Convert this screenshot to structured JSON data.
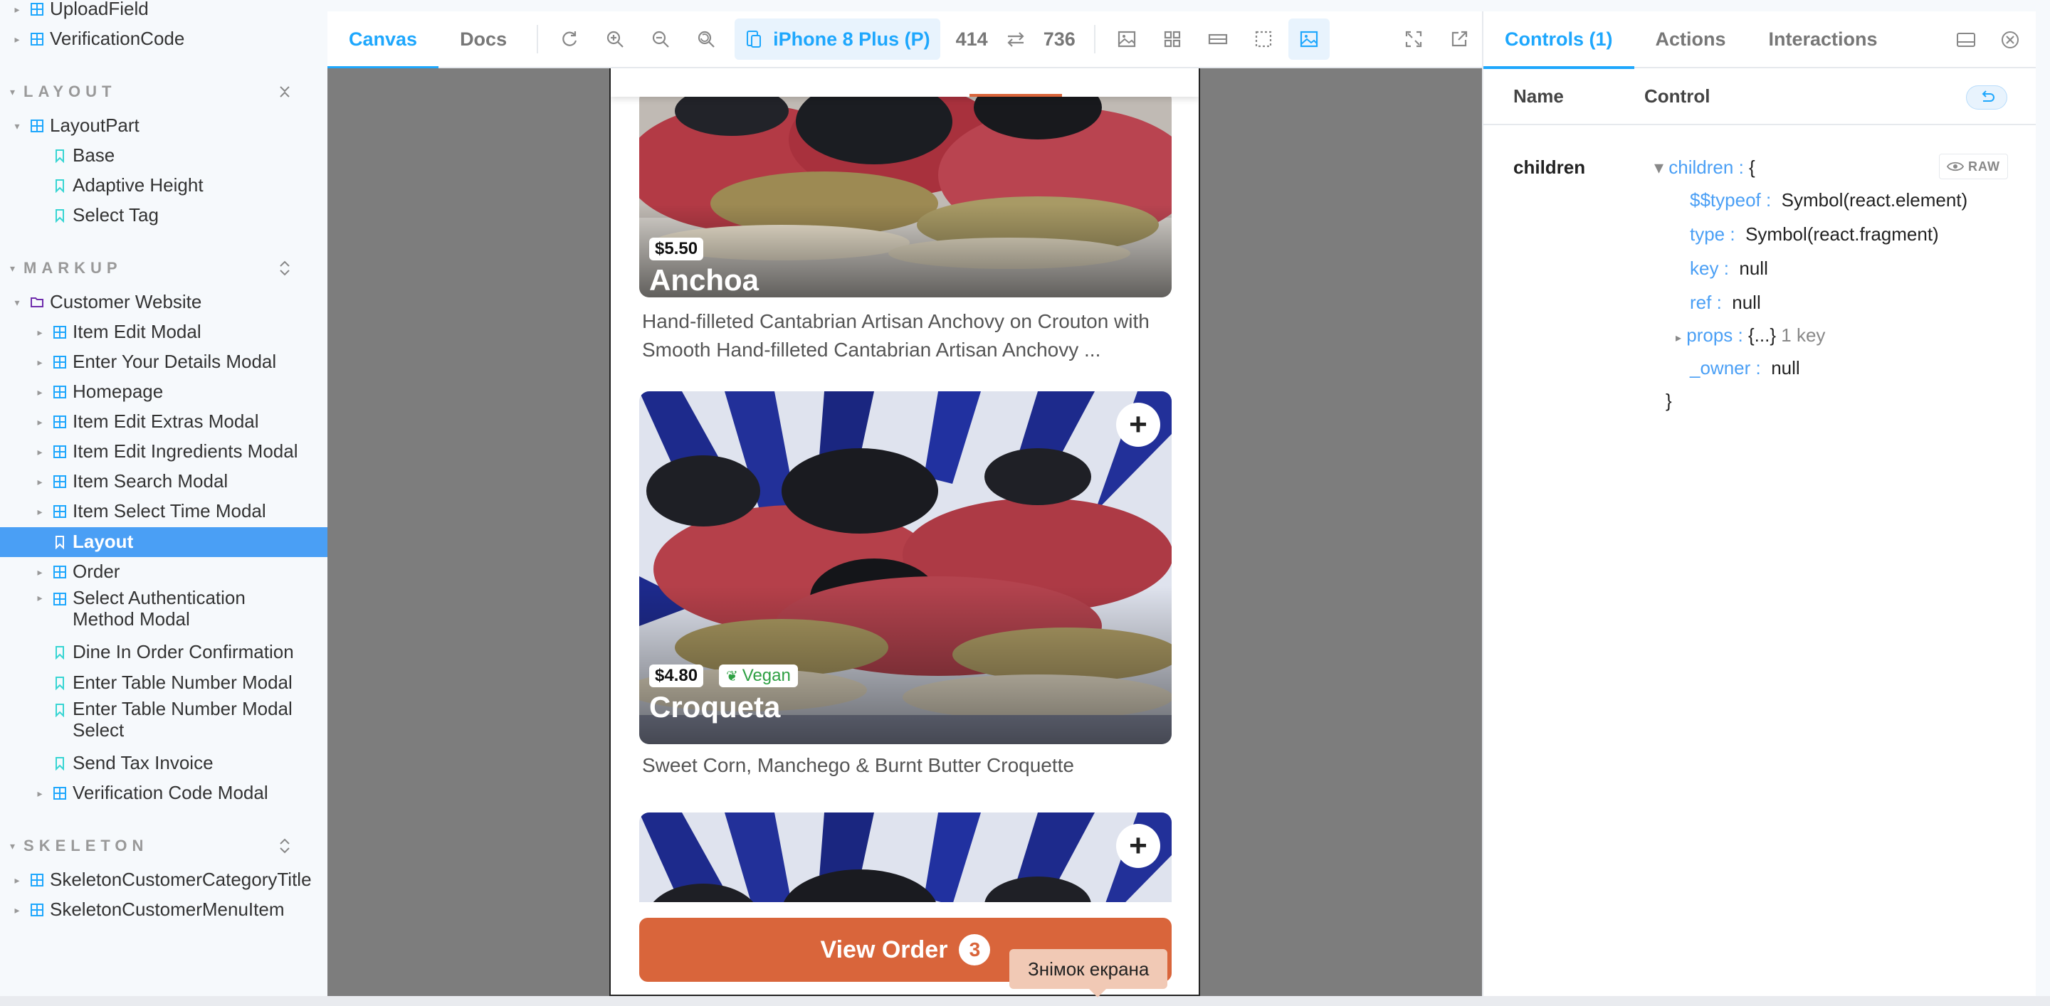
{
  "sidebar": {
    "top_items": [
      {
        "label": "UploadField"
      },
      {
        "label": "VerificationCode"
      }
    ],
    "sections": [
      {
        "title": "LAYOUT"
      },
      {
        "title": "MARKUP"
      },
      {
        "title": "SKELETON"
      }
    ],
    "layout_items": [
      {
        "label": "LayoutPart"
      },
      {
        "label": "Base"
      },
      {
        "label": "Adaptive Height"
      },
      {
        "label": "Select Tag"
      }
    ],
    "markup_group": "Customer Website",
    "markup_items": [
      {
        "label": "Item Edit Modal"
      },
      {
        "label": "Enter Your Details Modal"
      },
      {
        "label": "Homepage"
      },
      {
        "label": "Item Edit Extras Modal"
      },
      {
        "label": "Item Edit Ingredients Modal"
      },
      {
        "label": "Item Search Modal"
      },
      {
        "label": "Item Select Time Modal"
      },
      {
        "label": "Layout"
      },
      {
        "label": "Order"
      },
      {
        "label": "Select Authentication Method Modal"
      },
      {
        "label": "Dine In Order Confirmation"
      },
      {
        "label": "Enter Table Number Modal"
      },
      {
        "label": "Enter Table Number Modal Select"
      },
      {
        "label": "Send Tax Invoice"
      },
      {
        "label": "Verification Code Modal"
      }
    ],
    "skeleton_items": [
      {
        "label": "SkeletonCustomerCategoryTitle"
      },
      {
        "label": "SkeletonCustomerMenuItem"
      }
    ]
  },
  "toolbar": {
    "tabs": [
      {
        "label": "Canvas"
      },
      {
        "label": "Docs"
      }
    ],
    "device": "iPhone 8 Plus (P)",
    "width": "414",
    "height": "736"
  },
  "phone": {
    "cards": [
      {
        "price": "$5.50",
        "title": "Anchoa",
        "description": "Hand-filleted Cantabrian Artisan Anchovy on Crouton with Smooth Hand-filleted Cantabrian Artisan Anchovy ..."
      },
      {
        "price": "$4.80",
        "badge": "Vegan",
        "title": "Croqueta",
        "description": "Sweet Corn, Manchego & Burnt Butter Croquette"
      }
    ],
    "view_order_label": "View Order",
    "view_order_count": "3"
  },
  "tooltip": "Знімок екрана",
  "right_panel": {
    "tabs": [
      {
        "label": "Controls (1)"
      },
      {
        "label": "Actions"
      },
      {
        "label": "Interactions"
      }
    ],
    "col_name": "Name",
    "col_control": "Control",
    "prop_name": "children",
    "raw_label": "RAW",
    "json": {
      "root_key": "children",
      "open_brace": "{",
      "close_brace": "}",
      "entries": [
        {
          "key": "$$typeof",
          "value": "Symbol(react.element)"
        },
        {
          "key": "type",
          "value": "Symbol(react.fragment)"
        },
        {
          "key": "key",
          "value": "null"
        },
        {
          "key": "ref",
          "value": "null"
        },
        {
          "key": "props",
          "value": "{...}",
          "note": "1 key"
        },
        {
          "key": "_owner",
          "value": "null"
        }
      ]
    }
  },
  "colors": {
    "accent": "#1ea7fd",
    "selected_row": "#4a9ff5",
    "brand_orange": "#d9653b",
    "vegan_green": "#2ea043"
  }
}
